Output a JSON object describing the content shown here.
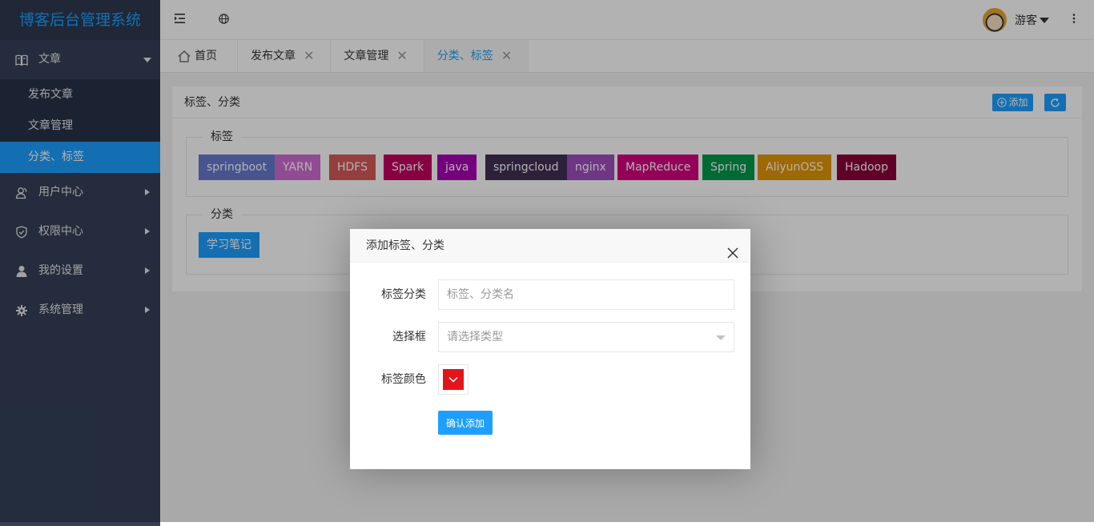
{
  "app": {
    "title": "博客后台管理系统"
  },
  "sidebar": {
    "items": [
      {
        "label": "文章",
        "icon": "book-icon",
        "expanded": true,
        "children": [
          {
            "label": "发布文章",
            "active": false
          },
          {
            "label": "文章管理",
            "active": false
          },
          {
            "label": "分类、标签",
            "active": true
          }
        ]
      },
      {
        "label": "用户中心",
        "icon": "users-icon"
      },
      {
        "label": "权限中心",
        "icon": "shield-icon"
      },
      {
        "label": "我的设置",
        "icon": "user-icon"
      },
      {
        "label": "系统管理",
        "icon": "gear-icon"
      }
    ]
  },
  "header": {
    "menu_toggle_icon": "indent-icon",
    "globe_icon": "globe-icon",
    "user_name": "游客",
    "more_icon": "more-vertical-icon"
  },
  "tabs": [
    {
      "label": "首页",
      "home": true,
      "closable": false
    },
    {
      "label": "发布文章",
      "closable": true
    },
    {
      "label": "文章管理",
      "closable": true
    },
    {
      "label": "分类、标签",
      "closable": true,
      "active": true
    }
  ],
  "card": {
    "title": "标签、分类",
    "add_label": "添加",
    "tag_section_label": "标签",
    "category_section_label": "分类",
    "tags": [
      {
        "label": "springboot",
        "color": "#6679cf"
      },
      {
        "label": "YARN",
        "color": "#cf6ed2"
      },
      {
        "label": "HDFS",
        "color": "#d65a59"
      },
      {
        "label": "Spark",
        "color": "#c2005f"
      },
      {
        "label": "java",
        "color": "#a800b3"
      },
      {
        "label": "springcloud",
        "color": "#3f2f54"
      },
      {
        "label": "nginx",
        "color": "#9e4ebf"
      },
      {
        "label": "MapReduce",
        "color": "#d5007e"
      },
      {
        "label": "Spring",
        "color": "#00994b"
      },
      {
        "label": "AliyunOSS",
        "color": "#e39607"
      },
      {
        "label": "Hadoop",
        "color": "#8a0038"
      }
    ],
    "categories": [
      {
        "label": "学习笔记",
        "color": "#1e9fff"
      }
    ]
  },
  "modal": {
    "title": "添加标签、分类",
    "name_label": "标签分类",
    "name_placeholder": "标签、分类名",
    "type_label": "选择框",
    "type_placeholder": "请选择类型",
    "color_label": "标签颜色",
    "color_value": "#e0161a",
    "submit_label": "确认添加"
  }
}
